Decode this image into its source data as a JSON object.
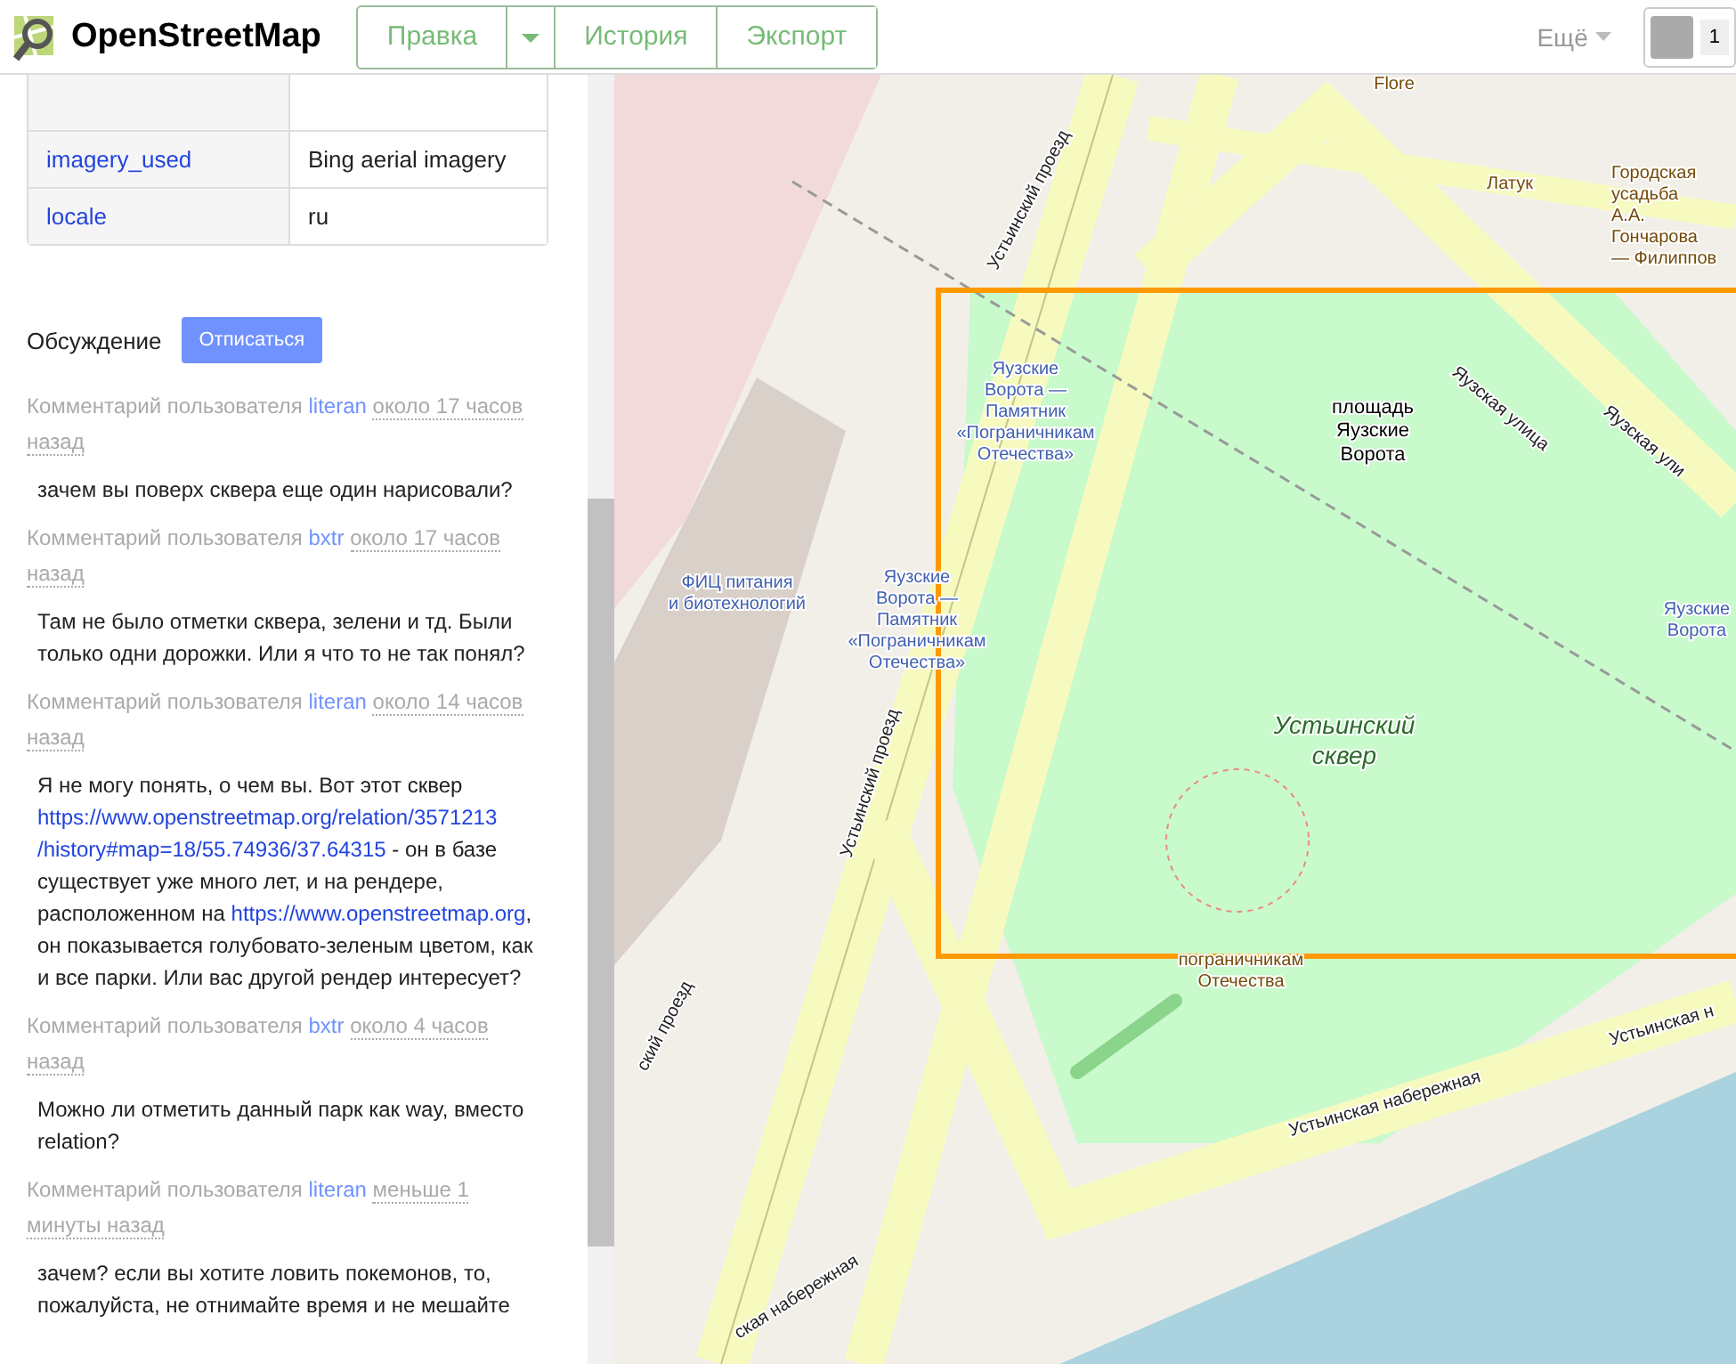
{
  "header": {
    "brand": "OpenStreetMap",
    "nav": [
      {
        "label": "Правка",
        "kind": "button"
      },
      {
        "kind": "caret"
      },
      {
        "label": "История",
        "kind": "button"
      },
      {
        "label": "Экспорт",
        "kind": "button"
      }
    ],
    "more": "Ещё",
    "user_count": "1"
  },
  "tags": [
    {
      "key": "imagery_used",
      "value": "Bing aerial imagery"
    },
    {
      "key": "locale",
      "value": "ru"
    }
  ],
  "discussion": {
    "title": "Обсуждение",
    "unsubscribe": "Отписаться",
    "comments": [
      {
        "prefix": "Комментарий пользователя",
        "user": "literan",
        "time": "около 17 часов назад",
        "body": [
          {
            "text": "зачем вы поверх сквера еще один нарисовали?",
            "link": false
          }
        ]
      },
      {
        "prefix": "Комментарий пользователя",
        "user": "bxtr",
        "time": "около 17 часов назад",
        "body": [
          {
            "text": "Там не было отметки сквера, зелени и тд. Были только одни дорожки. Или я что то не так понял?",
            "link": false
          }
        ]
      },
      {
        "prefix": "Комментарий пользователя",
        "user": "literan",
        "time": "около 14 часов назад",
        "body": [
          {
            "text": "Я не могу понять, о чем вы. Вот этот сквер ",
            "link": false
          },
          {
            "text": "https://www.openstreetmap.org/relation/3571213",
            "link": true
          },
          {
            "text": "/history#map=18/55.74936/37.64315",
            "link": true
          },
          {
            "text": " - он в базе существует уже много лет, и на рендере, расположенном на ",
            "link": false
          },
          {
            "text": "https://www.openstreetmap.org",
            "link": true
          },
          {
            "text": ", он показывается голубовато-зеленым цветом, как и все парки. Или вас другой рендер интересует?",
            "link": false
          }
        ]
      },
      {
        "prefix": "Комментарий пользователя",
        "user": "bxtr",
        "time": "около 4 часов назад",
        "body": [
          {
            "text": "Можно ли отметить данный парк как way, вместо relation?",
            "link": false
          }
        ]
      },
      {
        "prefix": "Комментарий пользователя",
        "user": "literan",
        "time": "меньше 1 минуты назад",
        "body": [
          {
            "text": "зачем? если вы хотите ловить покемонов, то, пожалуйста, не отнимайте время и не мешайте",
            "link": false
          }
        ]
      }
    ]
  },
  "map": {
    "labels": [
      {
        "text": "Flore",
        "kind": "poi"
      },
      {
        "text": "Латук",
        "kind": "poi"
      },
      {
        "text": "Городская\nусадьба\nА.А.\nГончарова\n— Филиппов",
        "kind": "poi"
      },
      {
        "text": "Яузские\nВорота —\nПамятник\n«Пограничникам\nОтечества»",
        "kind": "stop"
      },
      {
        "text": "ФИЦ питания\nи биотехнологий",
        "kind": "stop"
      },
      {
        "text": "Яузские\nВорота —\nПамятник\n«Пограничникам\nОтечества»",
        "kind": "stop"
      },
      {
        "text": "площадь\nЯузские\nВорота",
        "kind": "place"
      },
      {
        "text": "Яузская улица",
        "kind": "street"
      },
      {
        "text": "Яузская ули",
        "kind": "street"
      },
      {
        "text": "Яузские\nВорота",
        "kind": "stop"
      },
      {
        "text": "Устьинский\nсквер",
        "kind": "park"
      },
      {
        "text": "пограничникам\nОтечества",
        "kind": "poi"
      },
      {
        "text": "Устьинский проезд",
        "kind": "street"
      },
      {
        "text": "Устьинский проезд",
        "kind": "street"
      },
      {
        "text": "ский проезд",
        "kind": "street"
      },
      {
        "text": "Устьинская набережная",
        "kind": "street"
      },
      {
        "text": "Устьинская н",
        "kind": "street"
      },
      {
        "text": "ская набережная",
        "kind": "street"
      }
    ]
  }
}
